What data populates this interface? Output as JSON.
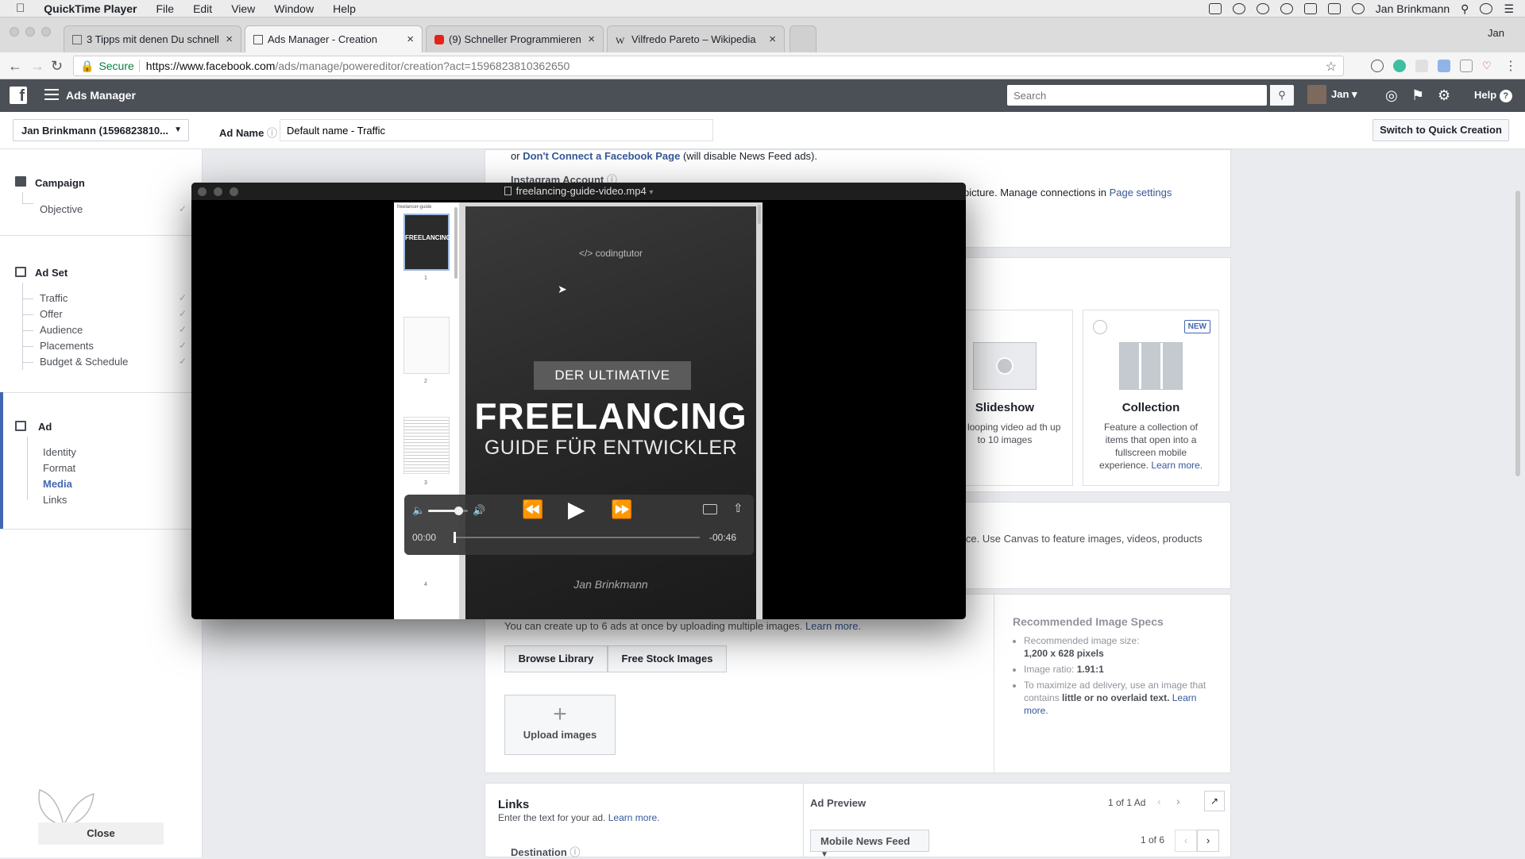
{
  "menubar": {
    "app": "QuickTime Player",
    "items": [
      "File",
      "Edit",
      "View",
      "Window",
      "Help"
    ],
    "user": "Jan Brinkmann"
  },
  "browser": {
    "tabs": [
      {
        "title": "3 Tipps mit denen Du schnelle",
        "icon": "document-icon"
      },
      {
        "title": "Ads Manager - Creation",
        "icon": "ads-icon"
      },
      {
        "title": "(9) Schneller Programmieren i",
        "icon": "youtube-icon"
      },
      {
        "title": "Vilfredo Pareto – Wikipedia",
        "icon": "wikipedia-icon"
      }
    ],
    "profile": "Jan",
    "secure_label": "Secure",
    "url_host": "https://www.facebook.com",
    "url_path": "/ads/manage/powereditor/creation?act=1596823810362650"
  },
  "fb": {
    "title": "Ads Manager",
    "search_placeholder": "Search",
    "user": "Jan",
    "help": "Help"
  },
  "toolbar": {
    "account": "Jan Brinkmann (1596823810...",
    "ad_name_label": "Ad Name",
    "ad_name_value": "Default name - Traffic",
    "quick_creation": "Switch to Quick Creation"
  },
  "sidebar": {
    "campaign": {
      "title": "Campaign",
      "items": [
        "Objective"
      ]
    },
    "adset": {
      "title": "Ad Set",
      "items": [
        "Traffic",
        "Offer",
        "Audience",
        "Placements",
        "Budget & Schedule"
      ]
    },
    "ad": {
      "title": "Ad",
      "items": [
        "Identity",
        "Format",
        "Media",
        "Links"
      ],
      "selected": "Media"
    },
    "close": "Close"
  },
  "content": {
    "dont_connect_pre": "or",
    "dont_connect_link": "Don't Connect a Facebook Page",
    "dont_connect_post": "(will disable News Feed ads).",
    "instagram_label": "Instagram Account",
    "instagram_text": "picture. Manage connections in",
    "page_settings": "Page settings",
    "formats": [
      {
        "title": "Slideshow",
        "desc": "te a looping video ad th up to 10 images"
      },
      {
        "title": "Collection",
        "desc": "Feature a collection of items that open into a fullscreen mobile experience.",
        "link": "Learn more.",
        "badge": "NEW"
      }
    ],
    "canvas_text": "ice. Use Canvas to feature images, videos, products",
    "upload_note": "You can create up to 6 ads at once by uploading multiple images.",
    "learn_more": "Learn more.",
    "browse_library": "Browse Library",
    "free_stock": "Free Stock Images",
    "upload_images": "Upload images",
    "specs": {
      "title": "Recommended Image Specs",
      "size_label": "Recommended image size:",
      "size_value": "1,200 x 628 pixels",
      "ratio_label": "Image ratio:",
      "ratio_value": "1.91:1",
      "tip_pre": "To maximize ad delivery, use an image that contains",
      "tip_bold": "little or no overlaid text.",
      "tip_link": "Learn more."
    },
    "links": {
      "title": "Links",
      "desc": "Enter the text for your ad.",
      "learn_more": "Learn more.",
      "destination": "Destination"
    },
    "preview": {
      "title": "Ad Preview",
      "count": "1 of 1 Ad",
      "placement": "Mobile News Feed",
      "page": "1 of 6"
    }
  },
  "quicktime": {
    "filename": "freelancing-guide-video.mp4",
    "pdf_sidebar_title": "freelancer-guide",
    "thumb_numbers": [
      "1",
      "2",
      "3",
      "4"
    ],
    "logo": "</> codingtutor",
    "slide_tag": "DER ULTIMATIVE",
    "slide_title": "FREELANCING",
    "slide_subtitle": "GUIDE FÜR ENTWICKLER",
    "slide_author": "Jan Brinkmann",
    "time_elapsed": "00:00",
    "time_remaining": "-00:46",
    "progress": 0.0,
    "volume": 0.75
  }
}
